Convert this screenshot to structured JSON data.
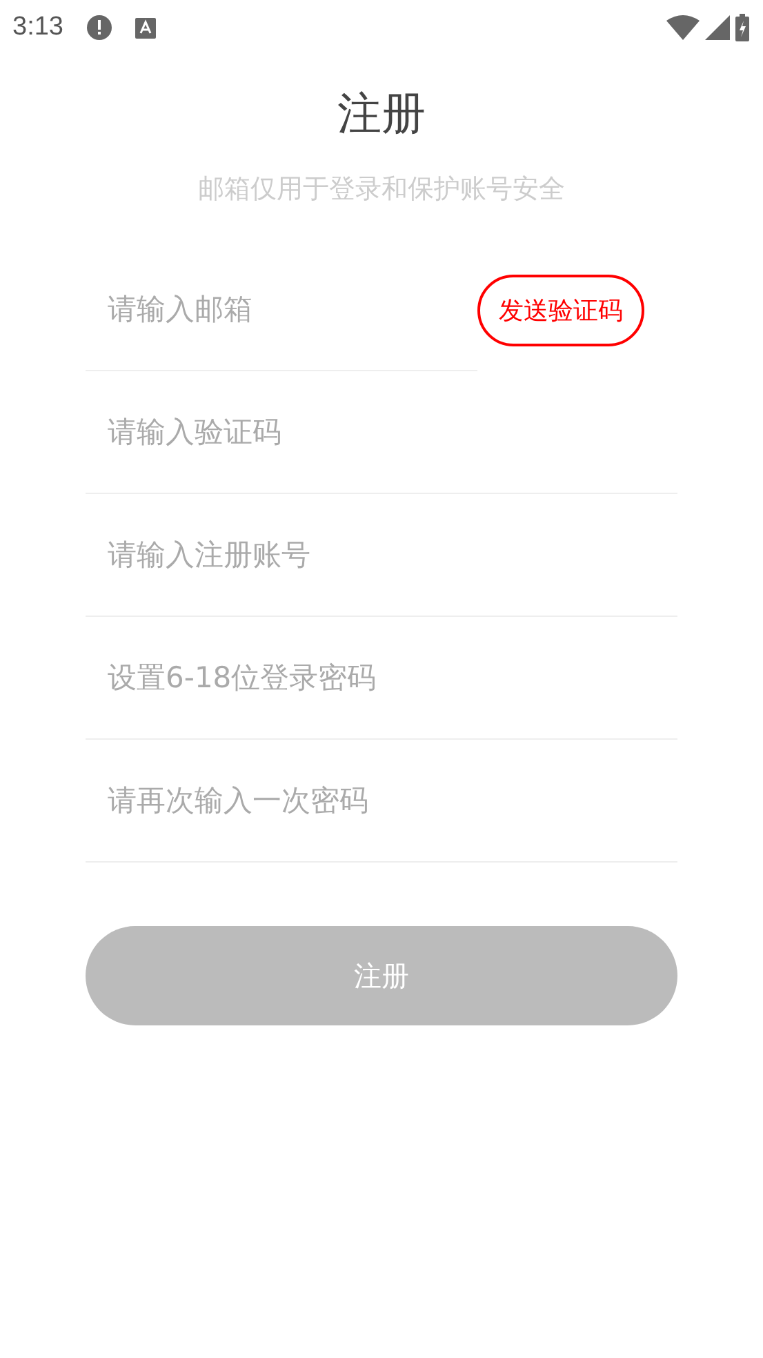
{
  "status_bar": {
    "time": "3:13"
  },
  "title": "注册",
  "subtitle": "邮箱仅用于登录和保护账号安全",
  "fields": [
    {
      "kind": "email",
      "placeholder": "请输入邮箱",
      "action": "发送验证码"
    },
    {
      "kind": "text",
      "placeholder": "请输入验证码"
    },
    {
      "kind": "text",
      "placeholder": "请输入注册账号"
    },
    {
      "kind": "text",
      "placeholder": "设置6-18位登录密码"
    },
    {
      "kind": "text",
      "placeholder": "请再次输入一次密码"
    }
  ],
  "submit": {
    "label": "注册",
    "disabled": true
  }
}
